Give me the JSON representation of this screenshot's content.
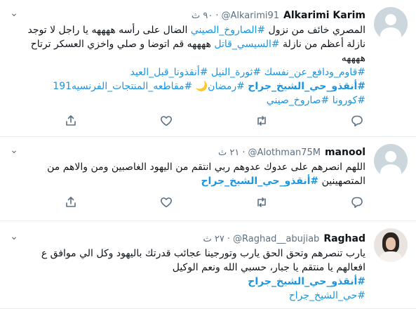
{
  "tweets": [
    {
      "name": "Alkarimi Karim",
      "handle": "@Alkarimi91",
      "time": "٩٠ ث",
      "body": {
        "line1": "المصري خائف من نزول",
        "tag1": "#الصاروخ_الصيني",
        "line1b": "الضال على رأسه ههههه يا راجل لا توجد",
        "line2a": "نازلة أعظم من نازلة",
        "tag2": "#السيسي_قاتل",
        "line2b": "ههههه قم اتوضا و صلي واخزي العسكر ترتاح",
        "line3": "ههههه",
        "tag3": "#قاوم_ودافع_عن_نفسك",
        "tag4": "#ثورة_النيل",
        "tag5": "#أنقذونا_قبل_العيد",
        "tag6": "#أنقذو_حي_الشيخ_جراح",
        "tag7": "#رمضان",
        "moon": "🌙",
        "tag8": "#مقاطعه_المنتجات_الفرنسيه191",
        "tag9": "#كورونا",
        "tag10": "#صاروخ_صيني"
      }
    },
    {
      "name": "manool",
      "handle": "@Alothman75M",
      "time": "٢١ ث",
      "body": {
        "line1": "اللهم انصرهم على عدوك عدوهم ربي انتقم من اليهود الغاصبين ومن والاهم من",
        "line2": "المتصهينين",
        "tag1": "#أنقذو_حي_الشيخ_جراح"
      }
    },
    {
      "name": "Raghad",
      "handle": "@Raghad__abujiab",
      "time": "٢٧ ث",
      "body": {
        "line1": "يارب تنصرهم وتحق الحق يارب وتورجينا عجائب قدرتك باليهود وكل الي موافق ع",
        "line2": "افعالهم يا منتقم يا جبار، حسبي الله ونعم الوكيل",
        "tag1": "#أنقذو_حي_الشيخ_جراح",
        "tag2": "#حي_الشيخ_جراح"
      }
    }
  ],
  "icons": {
    "reply": "reply-icon",
    "retweet": "retweet-icon",
    "like": "heart-icon",
    "share": "share-icon",
    "more": "more-options-icon"
  },
  "colors": {
    "link": "#1b95e0",
    "secondary": "#5b7083",
    "divider": "#e6ecf0"
  }
}
